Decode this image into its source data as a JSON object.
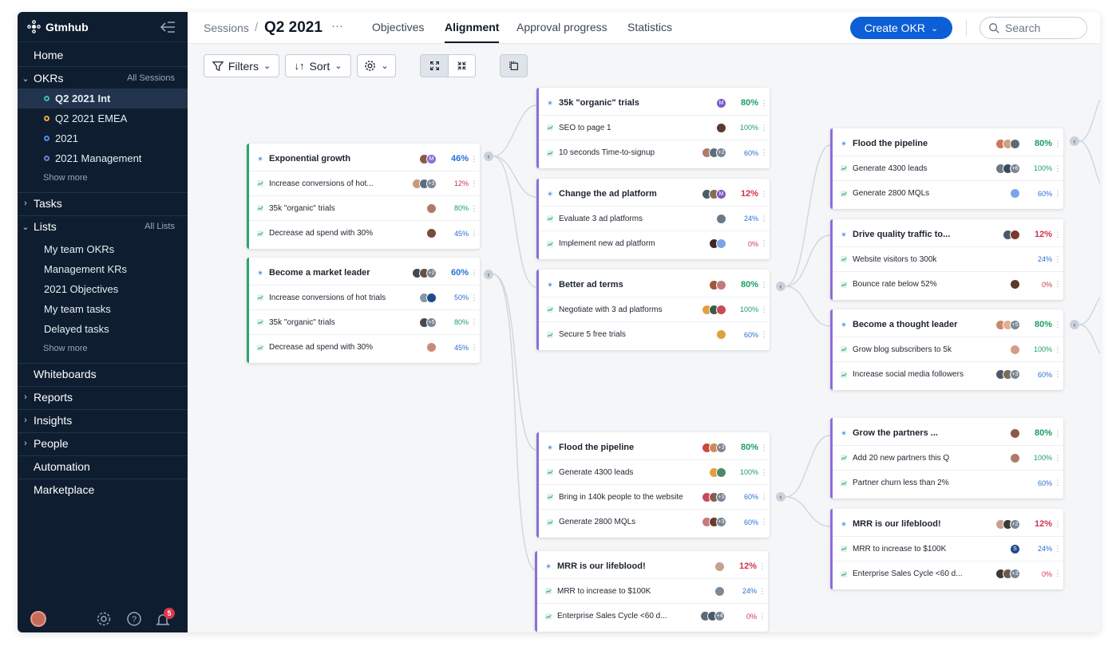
{
  "app": {
    "brand": "Gtmhub"
  },
  "colors": {
    "accent": "#0c5fd6",
    "sidebar_bg": "#0e1e30",
    "green": "#1a9e63",
    "red": "#d0334c",
    "blue": "#2a6fd6",
    "purple_bar": "#8b6ed8",
    "green_bar": "#2aa56f"
  },
  "sidebar": {
    "home": "Home",
    "okrs": {
      "label": "OKRs",
      "right": "All Sessions",
      "items": [
        {
          "label": "Q2 2021 Int",
          "color": "#35c3a6"
        },
        {
          "label": "Q2 2021 EMEA",
          "color": "#f2a33a"
        },
        {
          "label": "2021",
          "color": "#4a8fe7"
        },
        {
          "label": "2021 Management",
          "color": "#8a6fd8"
        }
      ],
      "show_more": "Show more"
    },
    "tasks": "Tasks",
    "lists": {
      "label": "Lists",
      "right": "All Lists",
      "items": [
        "My team OKRs",
        "Management KRs",
        "2021 Objectives",
        "My team tasks",
        "Delayed tasks"
      ],
      "show_more": "Show more"
    },
    "whiteboards": "Whiteboards",
    "reports": "Reports",
    "insights": "Insights",
    "people": "People",
    "automation": "Automation",
    "marketplace": "Marketplace",
    "notifications_count": "5"
  },
  "header": {
    "crumb": "Sessions",
    "title": "Q2 2021",
    "more": "···",
    "tabs": [
      "Objectives",
      "Alignment",
      "Approval progress",
      "Statistics"
    ],
    "active_tab": "Alignment",
    "create_button": "Create OKR",
    "search_placeholder": "Search"
  },
  "toolbar": {
    "filters": "Filters",
    "sort": "Sort"
  },
  "cards": [
    {
      "title": "Exponential growth",
      "pct": "46%",
      "status": "blue",
      "avatars": [
        "#8a5a44",
        "#8a6fd8"
      ],
      "avatar_letters": [
        "",
        "M"
      ],
      "more": "",
      "rows": [
        {
          "label": "Increase conversions of hot...",
          "pct": "12%",
          "status": "red",
          "avatars": [
            "#c99a7a",
            "#5a6e80"
          ],
          "more": "+3"
        },
        {
          "label": "35k \"organic\" trials",
          "pct": "80%",
          "status": "green",
          "avatars": [
            "#b07a6a"
          ],
          "more": ""
        },
        {
          "label": "Decrease ad spend with 30%",
          "pct": "45%",
          "status": "blue",
          "avatars": [
            "#7a4a3a"
          ],
          "more": ""
        }
      ]
    },
    {
      "title": "Become a market leader",
      "pct": "60%",
      "status": "blue",
      "avatars": [
        "#3d4a56",
        "#6a5040"
      ],
      "avatar_letters": [
        "",
        ""
      ],
      "more": "+2",
      "rows": [
        {
          "label": "Increase conversions of hot trials",
          "pct": "50%",
          "status": "blue",
          "avatars": [
            "#8896a4",
            "#1f4b8c"
          ],
          "more": ""
        },
        {
          "label": "35k \"organic\" trials",
          "pct": "80%",
          "status": "green",
          "avatars": [
            "#4a4a4a"
          ],
          "more": "+5"
        },
        {
          "label": "Decrease ad spend with 30%",
          "pct": "45%",
          "status": "blue",
          "avatars": [
            "#c98a7a"
          ],
          "more": ""
        }
      ]
    },
    {
      "title": "35k \"organic\" trials",
      "pct": "80%",
      "status": "green",
      "avatars": [
        "#7a5ac2"
      ],
      "avatar_letters": [
        "M"
      ],
      "more": "",
      "rows": [
        {
          "label": "SEO to page 1",
          "pct": "100%",
          "status": "green",
          "avatars": [
            "#5a3a2a"
          ],
          "more": ""
        },
        {
          "label": "10 seconds Time-to-signup",
          "pct": "60%",
          "status": "blue",
          "avatars": [
            "#b07a6a",
            "#5a6e80"
          ],
          "more": "+2"
        }
      ]
    },
    {
      "title": "Change the ad platform",
      "pct": "12%",
      "status": "red",
      "avatars": [
        "#4a5a68",
        "#8a6a5a",
        "#7a5ac2"
      ],
      "avatar_letters": [
        "",
        "",
        "M"
      ],
      "more": "",
      "rows": [
        {
          "label": "Evaluate 3 ad platforms",
          "pct": "24%",
          "status": "blue",
          "avatars": [
            "#6a7a88"
          ],
          "more": ""
        },
        {
          "label": "Implement new ad platform",
          "pct": "0%",
          "status": "red",
          "avatars": [
            "#3a2a2a",
            "#7aa6e8"
          ],
          "more": ""
        }
      ]
    },
    {
      "title": "Better ad terms",
      "pct": "80%",
      "status": "green",
      "avatars": [
        "#a0583a",
        "#c27a7a"
      ],
      "avatar_letters": [
        "",
        ""
      ],
      "more": "",
      "rows": [
        {
          "label": "Negotiate with 3 ad platforms",
          "pct": "100%",
          "status": "green",
          "avatars": [
            "#e0a040",
            "#3a5a4a",
            "#c84a5a"
          ],
          "more": ""
        },
        {
          "label": "Secure 5 free trials",
          "pct": "60%",
          "status": "blue",
          "avatars": [
            "#e0a040"
          ],
          "more": ""
        }
      ]
    },
    {
      "title": "Flood the pipeline",
      "pct": "80%",
      "status": "green",
      "avatars": [
        "#c87a5a",
        "#d0a080",
        "#5a6a78"
      ],
      "avatar_letters": [
        "",
        "",
        ""
      ],
      "more": "",
      "rows": [
        {
          "label": "Generate 4300 leads",
          "pct": "100%",
          "status": "green",
          "avatars": [
            "#6a7a88",
            "#3a4a5a"
          ],
          "more": "+6"
        },
        {
          "label": "Generate 2800 MQLs",
          "pct": "60%",
          "status": "blue",
          "avatars": [
            "#7aa6e8"
          ],
          "more": ""
        }
      ]
    },
    {
      "title": "Drive quality traffic to...",
      "pct": "12%",
      "status": "red",
      "avatars": [
        "#4a5a68",
        "#7a3a2a"
      ],
      "avatar_letters": [
        "",
        ""
      ],
      "more": "",
      "rows": [
        {
          "label": "Website visitors to 300k",
          "pct": "24%",
          "status": "blue",
          "avatars": [],
          "more": ""
        },
        {
          "label": "Bounce rate below 52%",
          "pct": "0%",
          "status": "red",
          "avatars": [
            "#5a3a2a"
          ],
          "more": ""
        }
      ]
    },
    {
      "title": "Become a thought leader",
      "pct": "80%",
      "status": "green",
      "avatars": [
        "#c88a6a",
        "#e0b090"
      ],
      "avatar_letters": [
        "",
        ""
      ],
      "more": "+5",
      "rows": [
        {
          "label": "Grow blog subscribers to 5k",
          "pct": "100%",
          "status": "green",
          "avatars": [
            "#d89a8a"
          ],
          "more": ""
        },
        {
          "label": "Increase social media followers",
          "pct": "60%",
          "status": "blue",
          "avatars": [
            "#4a5a68",
            "#7a6a5a"
          ],
          "more": "+3"
        }
      ]
    },
    {
      "title": "Flood the pipeline",
      "pct": "80%",
      "status": "green",
      "avatars": [
        "#c84a3a",
        "#d08a5a"
      ],
      "avatar_letters": [
        "",
        ""
      ],
      "more": "+3",
      "rows": [
        {
          "label": "Generate 4300 leads",
          "pct": "100%",
          "status": "green",
          "avatars": [
            "#e0a040",
            "#4a8a6a"
          ],
          "more": ""
        },
        {
          "label": "Bring in 140k people to the website",
          "pct": "60%",
          "status": "blue",
          "avatars": [
            "#c84a5a",
            "#8a5a4a"
          ],
          "more": "+3"
        },
        {
          "label": "Generate 2800 MQLs",
          "pct": "60%",
          "status": "blue",
          "avatars": [
            "#c87a7a",
            "#6a3a2a"
          ],
          "more": "+3"
        }
      ]
    },
    {
      "title": "Grow the partners ...",
      "pct": "80%",
      "status": "green",
      "avatars": [
        "#8a5a4a"
      ],
      "avatar_letters": [
        ""
      ],
      "more": "",
      "rows": [
        {
          "label": "Add 20 new partners this Q",
          "pct": "100%",
          "status": "green",
          "avatars": [
            "#b07a6a"
          ],
          "more": ""
        },
        {
          "label": "Partner churn less than 2%",
          "pct": "60%",
          "status": "blue",
          "avatars": [],
          "more": ""
        }
      ]
    },
    {
      "title": "MRR is our lifeblood!",
      "pct": "12%",
      "status": "red",
      "avatars": [
        "#c8a090"
      ],
      "avatar_letters": [
        ""
      ],
      "more": "",
      "rows": [
        {
          "label": "MRR to increase to $100K",
          "pct": "24%",
          "status": "blue",
          "avatars": [
            "#7a8a98"
          ],
          "more": ""
        },
        {
          "label": "Enterprise Sales Cycle <60 d...",
          "pct": "0%",
          "status": "red",
          "avatars": [
            "#5a6a78",
            "#4a5a68"
          ],
          "more": "+4"
        }
      ]
    },
    {
      "title": "MRR is our lifeblood!",
      "pct": "12%",
      "status": "red",
      "avatars": [
        "#c8a090",
        "#3a3a3a"
      ],
      "avatar_letters": [
        "",
        ""
      ],
      "more": "+2",
      "rows": [
        {
          "label": "MRR to increase to $100K",
          "pct": "24%",
          "status": "blue",
          "avatars": [
            "#1f4b8c"
          ],
          "avatar_letters": [
            "S"
          ],
          "more": ""
        },
        {
          "label": "Enterprise Sales Cycle <60 d...",
          "pct": "0%",
          "status": "red",
          "avatars": [
            "#3a3a3a",
            "#6a5a4a"
          ],
          "more": "+3"
        }
      ]
    }
  ]
}
